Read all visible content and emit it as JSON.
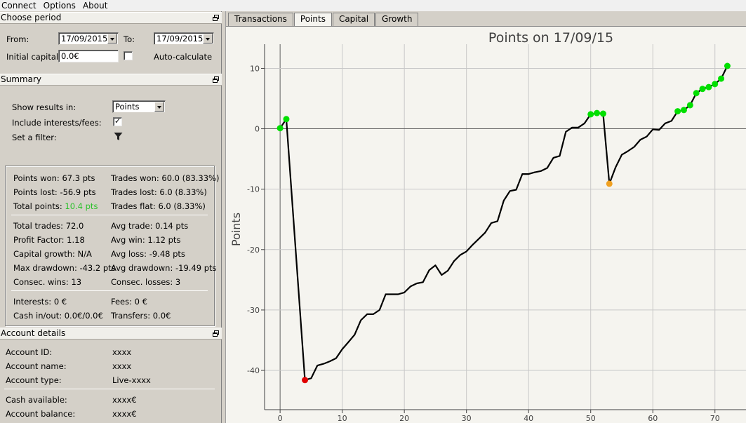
{
  "menu": [
    "Connect",
    "Options",
    "About"
  ],
  "choose_period": {
    "title": "Choose period",
    "from_label": "From:",
    "from_value": "17/09/2015",
    "to_label": "To:",
    "to_value": "17/09/2015",
    "capital_label": "Initial capital:",
    "capital_value": "0.0€",
    "auto_label": "Auto-calculate"
  },
  "summary": {
    "title": "Summary",
    "show_results_label": "Show results in:",
    "show_results_value": "Points",
    "include_fees_label": "Include interests/fees:",
    "filter_label": "Set a filter:",
    "left_col": [
      "Points won: 67.3 pts",
      "Points lost: -56.9 pts",
      "Total points: ",
      "Total trades: 72.0",
      "Profit Factor: 1.18",
      "Capital growth: N/A",
      "Max drawdown: -43.2 pts",
      "Consec. wins: 13",
      "Interests: 0 €",
      "Cash in/out: 0.0€/0.0€"
    ],
    "total_points_value": "10.4 pts",
    "right_col": [
      "Trades won: 60.0 (83.33%)",
      "Trades lost: 6.0 (8.33%)",
      "Trades flat: 6.0 (8.33%)",
      "Avg trade: 0.14 pts",
      "Avg win: 1.12 pts",
      "Avg loss: -9.48 pts",
      "Avg drawdown: -19.49 pts",
      "Consec. losses: 3",
      "Fees: 0 €",
      "Transfers: 0.0€"
    ]
  },
  "account": {
    "title": "Account details",
    "rows": [
      {
        "label": "Account ID:",
        "value": "xxxx"
      },
      {
        "label": "Account name:",
        "value": "xxxx"
      },
      {
        "label": "Account type:",
        "value": "Live-xxxx"
      },
      {
        "label": "Cash available:",
        "value": "xxxx€"
      },
      {
        "label": "Account balance:",
        "value": "xxxx€"
      }
    ]
  },
  "tabs": [
    "Transactions",
    "Points",
    "Capital",
    "Growth"
  ],
  "active_tab": 1,
  "icons": {
    "panel_restore": "restore-window-icon",
    "filter": "funnel-filter-icon",
    "combo_arrow": "chevron-down-icon"
  },
  "colors": {
    "win": "#00e000",
    "loss": "#e00000",
    "flat": "#f0a020",
    "line": "#000000",
    "total_points": "#2dc22d"
  },
  "chart_data": {
    "type": "line",
    "title": "Points on 17/09/15",
    "ylabel": "Points",
    "xlabel": "",
    "xlim": [
      -2.5,
      75
    ],
    "ylim": [
      -46.5,
      14
    ],
    "xticks": [
      0,
      10,
      20,
      30,
      40,
      50,
      60,
      70
    ],
    "yticks": [
      10,
      0,
      -10,
      -20,
      -30,
      -40
    ],
    "grid": true,
    "x": [
      0,
      1,
      4,
      5,
      6,
      7,
      8,
      9,
      10,
      11,
      12,
      13,
      14,
      15,
      16,
      17,
      18,
      19,
      20,
      21,
      22,
      23,
      24,
      25,
      26,
      27,
      28,
      29,
      30,
      31,
      32,
      33,
      34,
      35,
      36,
      37,
      38,
      39,
      40,
      41,
      42,
      43,
      44,
      45,
      46,
      47,
      48,
      49,
      50,
      51,
      52,
      53,
      54,
      55,
      56,
      57,
      58,
      59,
      60,
      61,
      62,
      63,
      64,
      65,
      66,
      67,
      68,
      69,
      70,
      71,
      72
    ],
    "values": [
      0.1,
      1.6,
      -41.6,
      -41.3,
      -39.2,
      -38.9,
      -38.5,
      -38.0,
      -36.5,
      -35.3,
      -34.1,
      -31.7,
      -30.7,
      -30.7,
      -30.0,
      -27.4,
      -27.4,
      -27.4,
      -27.1,
      -26.1,
      -25.6,
      -25.4,
      -23.4,
      -22.6,
      -24.2,
      -23.5,
      -21.9,
      -20.9,
      -20.3,
      -19.2,
      -18.2,
      -17.2,
      -15.6,
      -15.3,
      -11.9,
      -10.3,
      -10.1,
      -7.5,
      -7.5,
      -7.2,
      -7.0,
      -6.5,
      -4.8,
      -4.5,
      -0.5,
      0.2,
      0.2,
      0.9,
      2.4,
      2.6,
      2.5,
      -9.1,
      -6.4,
      -4.3,
      -3.7,
      -3.0,
      -1.8,
      -1.3,
      -0.1,
      -0.2,
      0.9,
      1.3,
      2.9,
      3.1,
      3.9,
      5.9,
      6.6,
      6.9,
      7.4,
      8.3,
      10.4
    ],
    "point_colors": {
      "red": [
        4
      ],
      "orange": [
        53
      ],
      "green": [
        0,
        1,
        50,
        51,
        52,
        64,
        65,
        66,
        67,
        68,
        69,
        70,
        71,
        72
      ]
    }
  }
}
